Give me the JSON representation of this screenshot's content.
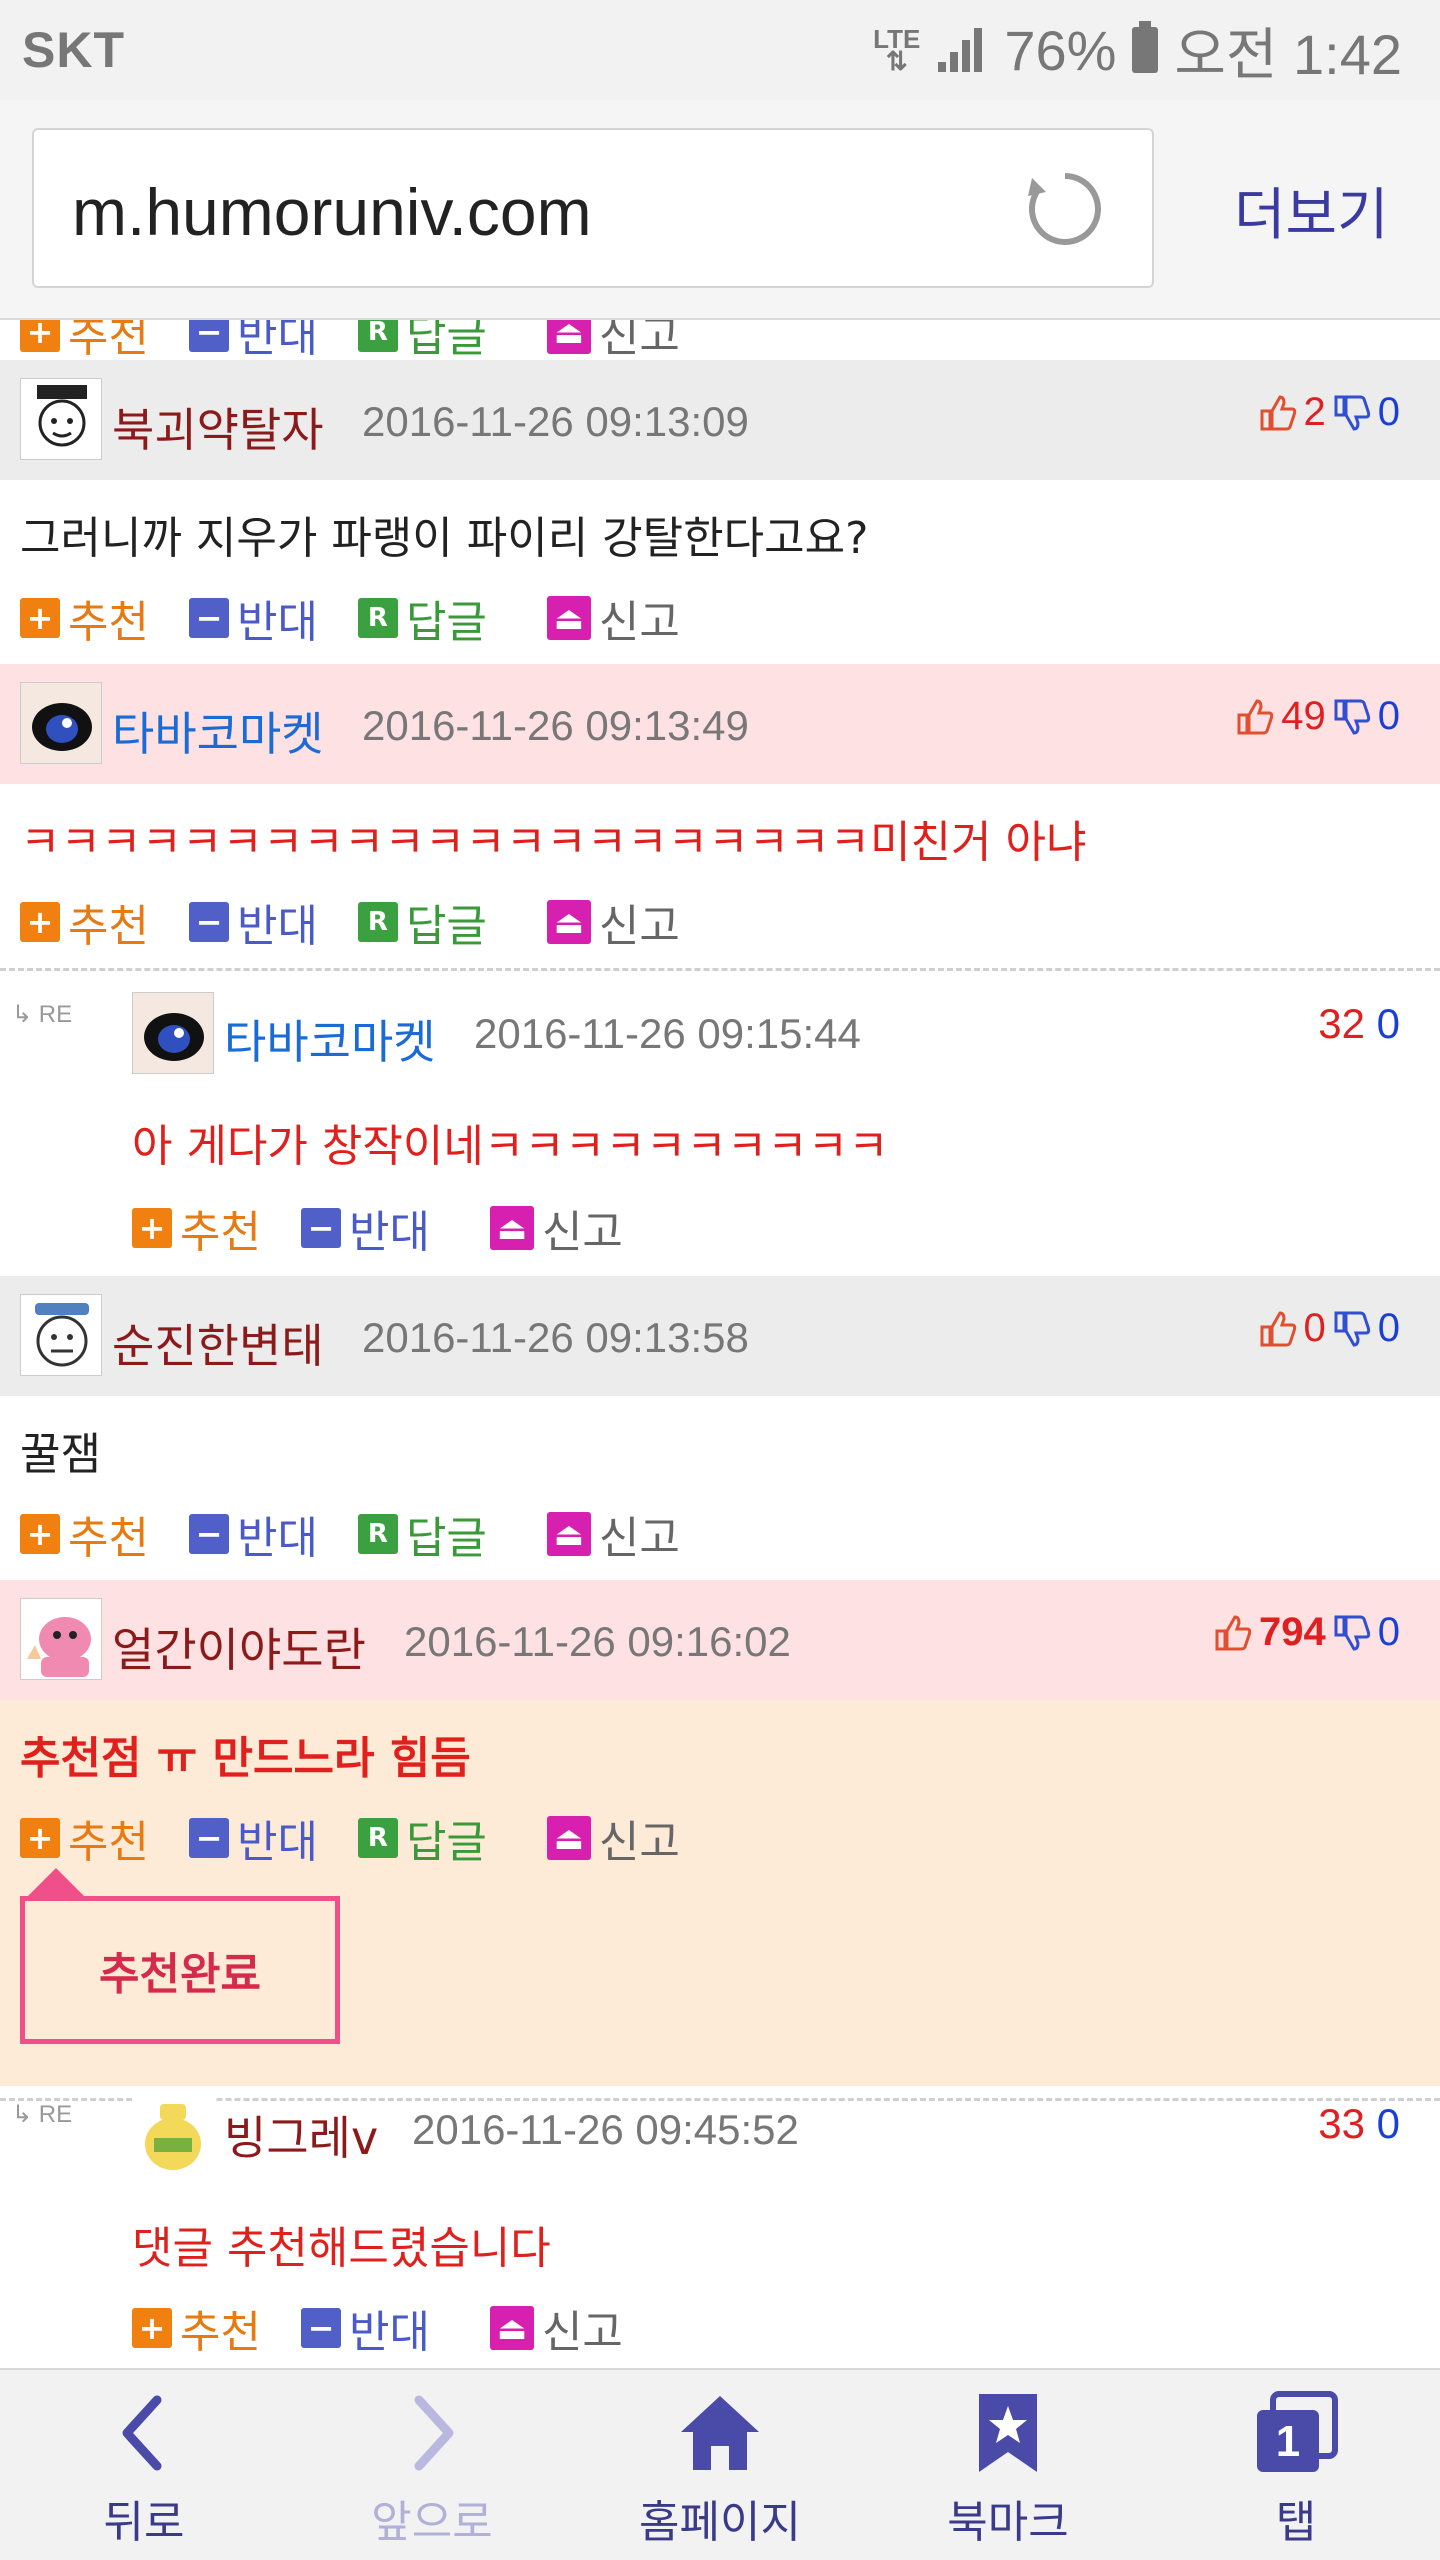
{
  "status_bar": {
    "carrier": "SKT",
    "network": "LTE",
    "battery": "76%",
    "time": "오전 1:42"
  },
  "browser": {
    "url": "m.humoruniv.com",
    "more_label": "더보기"
  },
  "action_labels": {
    "recommend": "추천",
    "oppose": "반대",
    "reply": "답글",
    "report": "신고",
    "reply_icon": "R"
  },
  "comments": [
    {
      "nick": "북괴약탈자",
      "date": "2016-11-26 09:13:09",
      "up": "2",
      "down": "0",
      "text": "그러니까 지우가 파랭이 파이리 강탈한다고요?"
    },
    {
      "nick": "타바코마켓",
      "date": "2016-11-26 09:13:49",
      "up": "49",
      "down": "0",
      "text": "ㅋㅋㅋㅋㅋㅋㅋㅋㅋㅋㅋㅋㅋㅋㅋㅋㅋㅋㅋㅋㅋ미친거 아냐",
      "reply": {
        "re": "RE",
        "nick": "타바코마켓",
        "date": "2016-11-26 09:15:44",
        "up": "32",
        "down": "0",
        "text": "아 게다가 창작이네ㅋㅋㅋㅋㅋㅋㅋㅋㅋㅋ"
      }
    },
    {
      "nick": "순진한변태",
      "date": "2016-11-26 09:13:58",
      "up": "0",
      "down": "0",
      "text": "꿀잼"
    },
    {
      "nick": "얼간이야도란",
      "date": "2016-11-26 09:16:02",
      "up": "794",
      "down": "0",
      "text": "추천점 ㅠ 만드느라 힘듬",
      "popup": "추천완료",
      "reply": {
        "re": "RE",
        "nick": "빙그레v",
        "date": "2016-11-26 09:45:52",
        "up": "33",
        "down": "0",
        "text": "댓글 추천해드렸습니다"
      }
    }
  ],
  "bottom_nav": [
    {
      "label": "뒤로",
      "icon": "back-icon"
    },
    {
      "label": "앞으로",
      "icon": "forward-icon"
    },
    {
      "label": "홈페이지",
      "icon": "home-icon"
    },
    {
      "label": "북마크",
      "icon": "bookmark-icon"
    },
    {
      "label": "탭",
      "icon": "tabs-icon",
      "count": "1"
    }
  ],
  "colors": {
    "nick": "#8b1a1a",
    "nick_blue": "#1a6bd6",
    "up": "#e02020",
    "down": "#1a3fd6",
    "pink_header": "#fde1e3",
    "peach_body": "#fdebd8",
    "gray_header": "#ececec"
  }
}
